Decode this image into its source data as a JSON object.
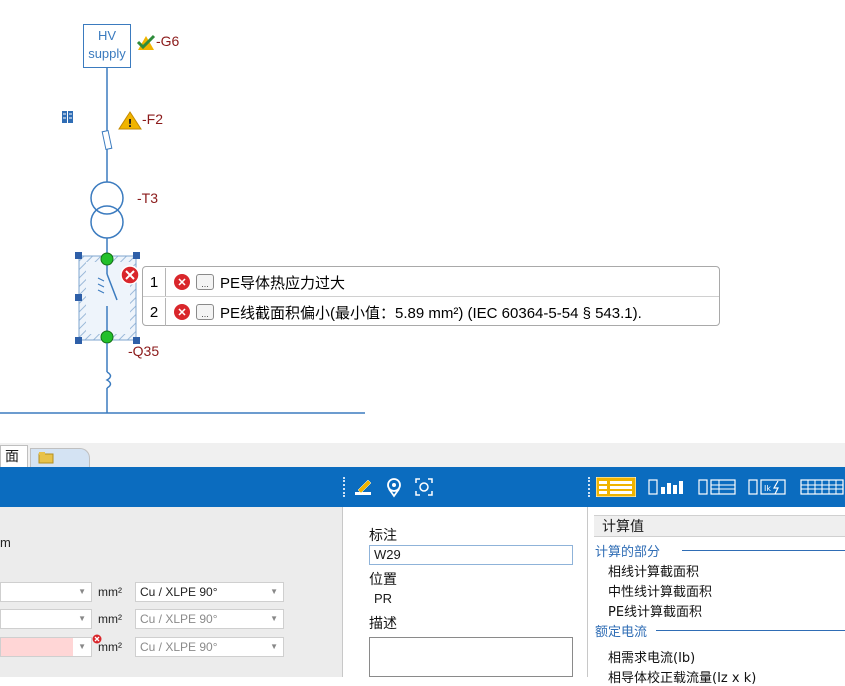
{
  "diagram": {
    "hv_supply": {
      "line1": "HV",
      "line2": "supply"
    },
    "labels": {
      "g6": "-G6",
      "f2": "-F2",
      "t3": "-T3",
      "q35": "-Q35"
    }
  },
  "error_popup": {
    "rows": [
      {
        "num": "1",
        "text": "PE导体热应力过大"
      },
      {
        "num": "2",
        "text": "PE线截面积偏小(最小值：5.89 mm²) (IEC 60364-5-54 § 543.1)."
      }
    ],
    "dots_label": "..."
  },
  "bottom": {
    "tab_label": "面",
    "left_panel": {
      "unit_m": "m",
      "rows": [
        {
          "unit": "mm²",
          "material": "Cu / XLPE 90°",
          "dim": false,
          "error": false
        },
        {
          "unit": "mm²",
          "material": "Cu / XLPE 90°",
          "dim": true,
          "error": false
        },
        {
          "unit": "mm²",
          "material": "Cu / XLPE 90°",
          "dim": true,
          "error": true
        }
      ]
    },
    "mid_panel": {
      "label_tag": "标注",
      "value_tag": "W29",
      "label_position": "位置",
      "value_position": "PR",
      "label_desc": "描述",
      "value_desc": ""
    },
    "right_panel": {
      "header": "计算值",
      "groups": [
        {
          "title": "计算的部分",
          "items": [
            "相线计算截面积",
            "中性线计算截面积",
            "PE线计算截面积"
          ]
        },
        {
          "title": "额定电流",
          "items": [
            "相需求电流(Ib)",
            "相导体校正载流量(Iz x k)"
          ]
        }
      ]
    }
  },
  "colors": {
    "accent": "#0b6cbf",
    "error": "#d9262b",
    "label": "#8b1a1a",
    "wire": "#3b7bbf"
  }
}
